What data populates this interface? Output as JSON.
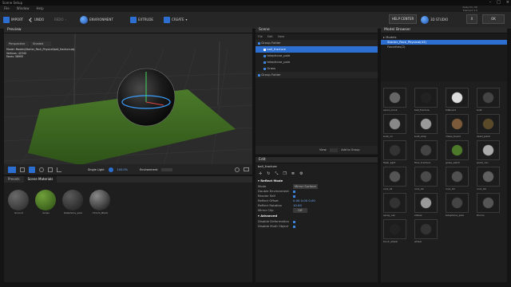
{
  "window": {
    "title": "Scene Setup",
    "controls": [
      "–",
      "□",
      "×"
    ]
  },
  "menu": [
    "File",
    "Window",
    "Help"
  ],
  "brand": {
    "line1": "Nuke Pro 3D",
    "line2": "Element 3.0"
  },
  "toolbar": {
    "import": "IMPORT",
    "undo": "UNDO",
    "redo": "REDO",
    "environment": "ENVIRONMENT",
    "extrude": "EXTRUDE",
    "create": "CREATE",
    "help": "HELP CENTER",
    "studio": "3D STUDIO",
    "x_label": "X",
    "ok": "OK"
  },
  "viewport": {
    "title": "Preview",
    "draft": "Draft Textures",
    "view_mode": "Perspective",
    "shading": "Shaded",
    "info_model_label": "Model:",
    "info_model_value": "Models\\Starter_Pack_Physical\\ball_fracture.obj",
    "info_vertices_label": "Vertices:",
    "info_vertices_value": "42340",
    "info_faces_label": "Faces:",
    "info_faces_value": "58995",
    "light_label": "Single Light",
    "light_value": "100.0%",
    "env_label": "Environment"
  },
  "materials": {
    "tabs": [
      "Presets",
      "Scene Materials"
    ],
    "items": [
      "Ground",
      "Grass",
      "telephone_pole",
      "Chrom_Black"
    ]
  },
  "scene": {
    "title": "Scene",
    "menu": [
      "File",
      "Edit",
      "View"
    ],
    "tree": [
      "Group Folder",
      "ball_fracture",
      "telephone_pole",
      "telephone_pole",
      "Grass",
      "Group Folder"
    ],
    "view_label": "View:",
    "add_group": "Add to Group"
  },
  "edit": {
    "title": "Edit",
    "object": "ball_fracture",
    "section1": "Reflect Mode",
    "props": [
      {
        "label": "Mode",
        "value": "Mirror Surface"
      },
      {
        "label": "Double Environment",
        "value": ""
      },
      {
        "label": "Render Self",
        "value": ""
      },
      {
        "label": "Reflect Offset",
        "value": "0.00  0.00  0.00"
      },
      {
        "label": "Reflect Rotation",
        "value": "10.00"
      },
      {
        "label": "Mirror Clip",
        "value": "Off"
      }
    ],
    "section2": "Advanced",
    "advanced": [
      {
        "label": "Disable Deformation",
        "value": ""
      },
      {
        "label": "Disable Multi Object",
        "value": ""
      }
    ]
  },
  "browser": {
    "title": "Model Browser",
    "tree": [
      "Models",
      "Starter_Pack_Physical(43)",
      "Favorites(2)"
    ],
    "items": [
      "apron_hook",
      "ball_fracture",
      "billboard",
      "bulb",
      "bulb_on",
      "bulb_strip",
      "chess_board",
      "dead_plant",
      "flash_light",
      "floor_fracture",
      "grass_patch",
      "paint_can",
      "rock_01",
      "rock_02",
      "rock_03",
      "rock_04",
      "spray_can",
      "statue",
      "telephone_pole",
      "thorns",
      "truck_wheel",
      "wheel"
    ]
  }
}
